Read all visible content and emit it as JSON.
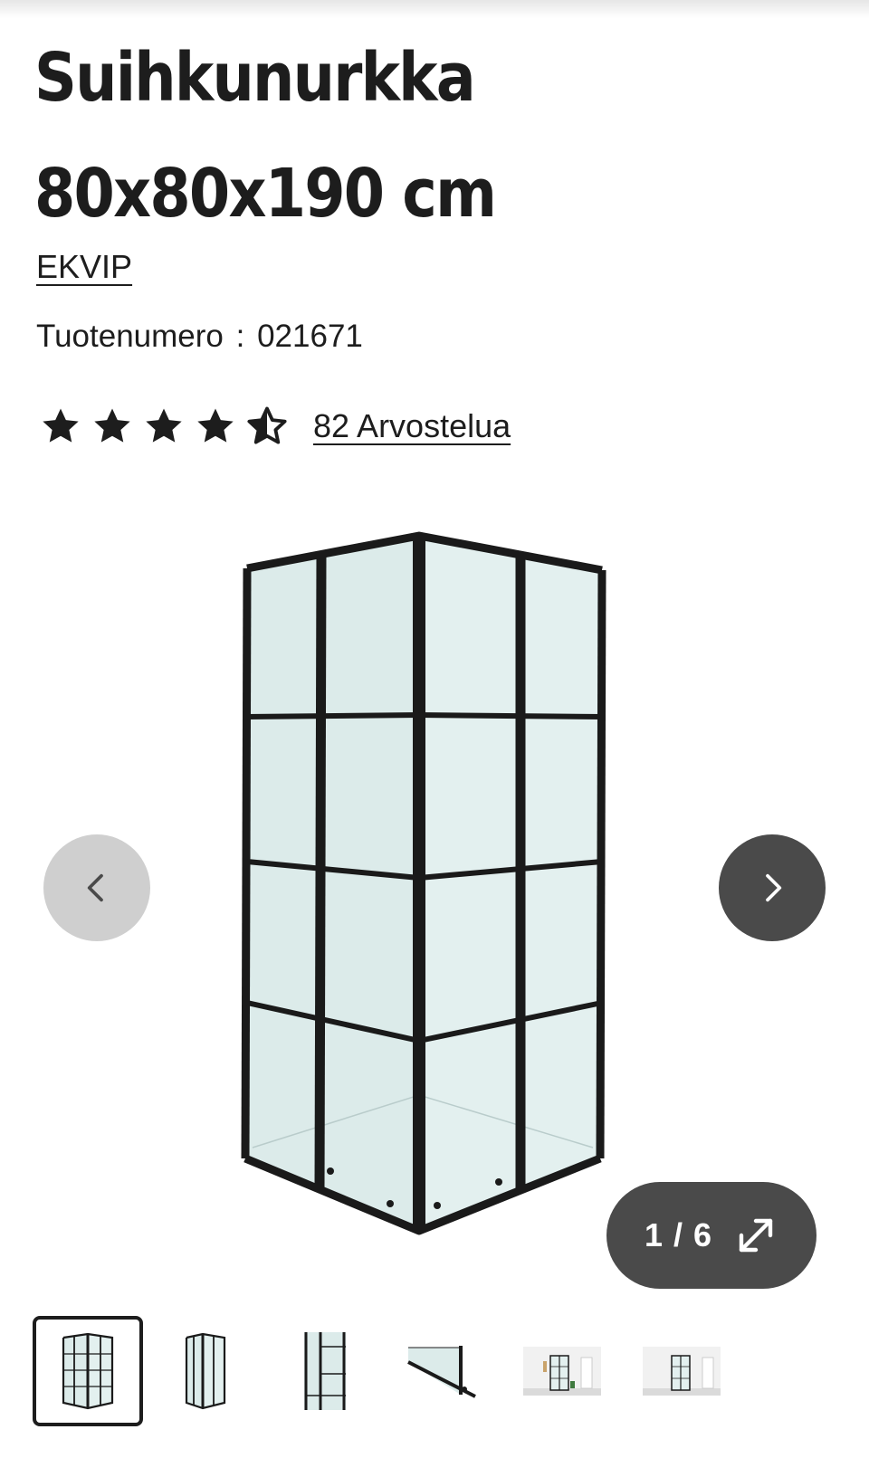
{
  "product": {
    "title": "Suihkunurkka 80x80x190 cm",
    "brand": "EKVIP",
    "sku_label": "Tuotenumero",
    "sku_separator": ":",
    "sku_value": "021671"
  },
  "rating": {
    "value": 4.5,
    "max": 5,
    "reviews_label": "82 Arvostelua"
  },
  "gallery": {
    "counter": "1 / 6",
    "current": 1,
    "total": 6,
    "prev_icon": "chevron-left-icon",
    "next_icon": "chevron-right-icon",
    "expand_icon": "expand-icon"
  },
  "thumbnails": [
    {
      "name": "thumb-front-view",
      "active": true
    },
    {
      "name": "thumb-side-view",
      "active": false
    },
    {
      "name": "thumb-panel-detail",
      "active": false
    },
    {
      "name": "thumb-profile-detail",
      "active": false
    },
    {
      "name": "thumb-bathroom-1",
      "active": false
    },
    {
      "name": "thumb-bathroom-2",
      "active": false
    }
  ],
  "colors": {
    "text": "#1d1d1d",
    "nav_prev_bg": "#cfcfcf",
    "nav_dark_bg": "#4a4a4a",
    "glass": "#dcebea",
    "frame": "#1a1a1a"
  }
}
